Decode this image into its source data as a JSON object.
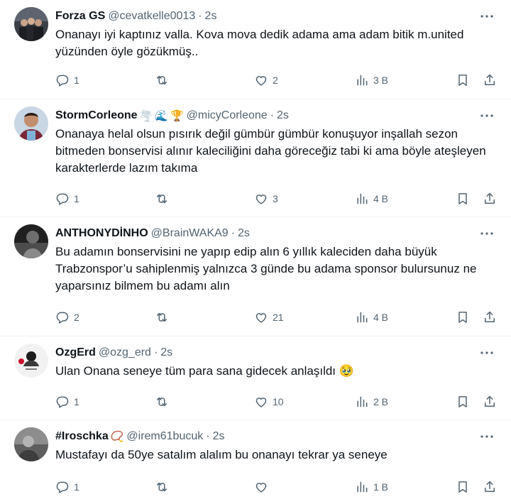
{
  "tweets": [
    {
      "name": "Forza GS",
      "emojis": [],
      "handle": "@cevatkelle0013",
      "time": "2s",
      "text": "Onanayı iyi kaptınız valla. Kova mova dedik adama ama adam bitik m.united yüzünden öyle gözükmüş..",
      "replies": "1",
      "retweets": "",
      "likes": "2",
      "views": "3 B"
    },
    {
      "name": "StormCorleone",
      "emojis": [
        "🌪️",
        "🌊",
        "🏆"
      ],
      "handle": "@micyCorleone",
      "time": "2s",
      "text": "Onanaya helal olsun pısırık değil gümbür gümbür konuşuyor inşallah sezon bitmeden bonservisi alınır kaleciliğini daha göreceğiz tabi ki ama böyle ateşleyen karakterlerde lazım takıma",
      "replies": "1",
      "retweets": "",
      "likes": "3",
      "views": "4 B"
    },
    {
      "name": "ANTHONYDİNHO",
      "emojis": [],
      "handle": "@BrainWAKA9",
      "time": "2s",
      "text": "Bu adamın bonservisini ne yapıp edip alın 6 yıllık kaleciden daha büyük Trabzonspor’u sahiplenmiş yalnızca 3 günde bu adama sponsor bulursunuz ne yaparsınız bilmem bu adamı alın",
      "replies": "2",
      "retweets": "",
      "likes": "21",
      "views": "4 B"
    },
    {
      "name": "OzgErd",
      "emojis": [],
      "handle": "@ozg_erd",
      "time": "2s",
      "text": "Ulan Onana seneye tüm para sana gidecek anlaşıldı 🥹",
      "replies": "1",
      "retweets": "",
      "likes": "10",
      "views": "2 B"
    },
    {
      "name": "#Iroschka",
      "emojis": [
        "📿"
      ],
      "handle": "@irem61bucuk",
      "time": "2s",
      "text": "Mustafayı da 50ye satalım alalım bu onanayı tekrar ya seneye",
      "replies": "1",
      "retweets": "",
      "likes": "",
      "views": "1 B"
    }
  ],
  "icons": {
    "reply": "reply-icon",
    "retweet": "retweet-icon",
    "like": "heart-icon",
    "views": "views-icon",
    "bookmark": "bookmark-icon",
    "share": "share-icon",
    "more": "more-icon"
  },
  "colors": {
    "text": "#0f1419",
    "muted": "#536471",
    "divider": "#eff3f4"
  }
}
